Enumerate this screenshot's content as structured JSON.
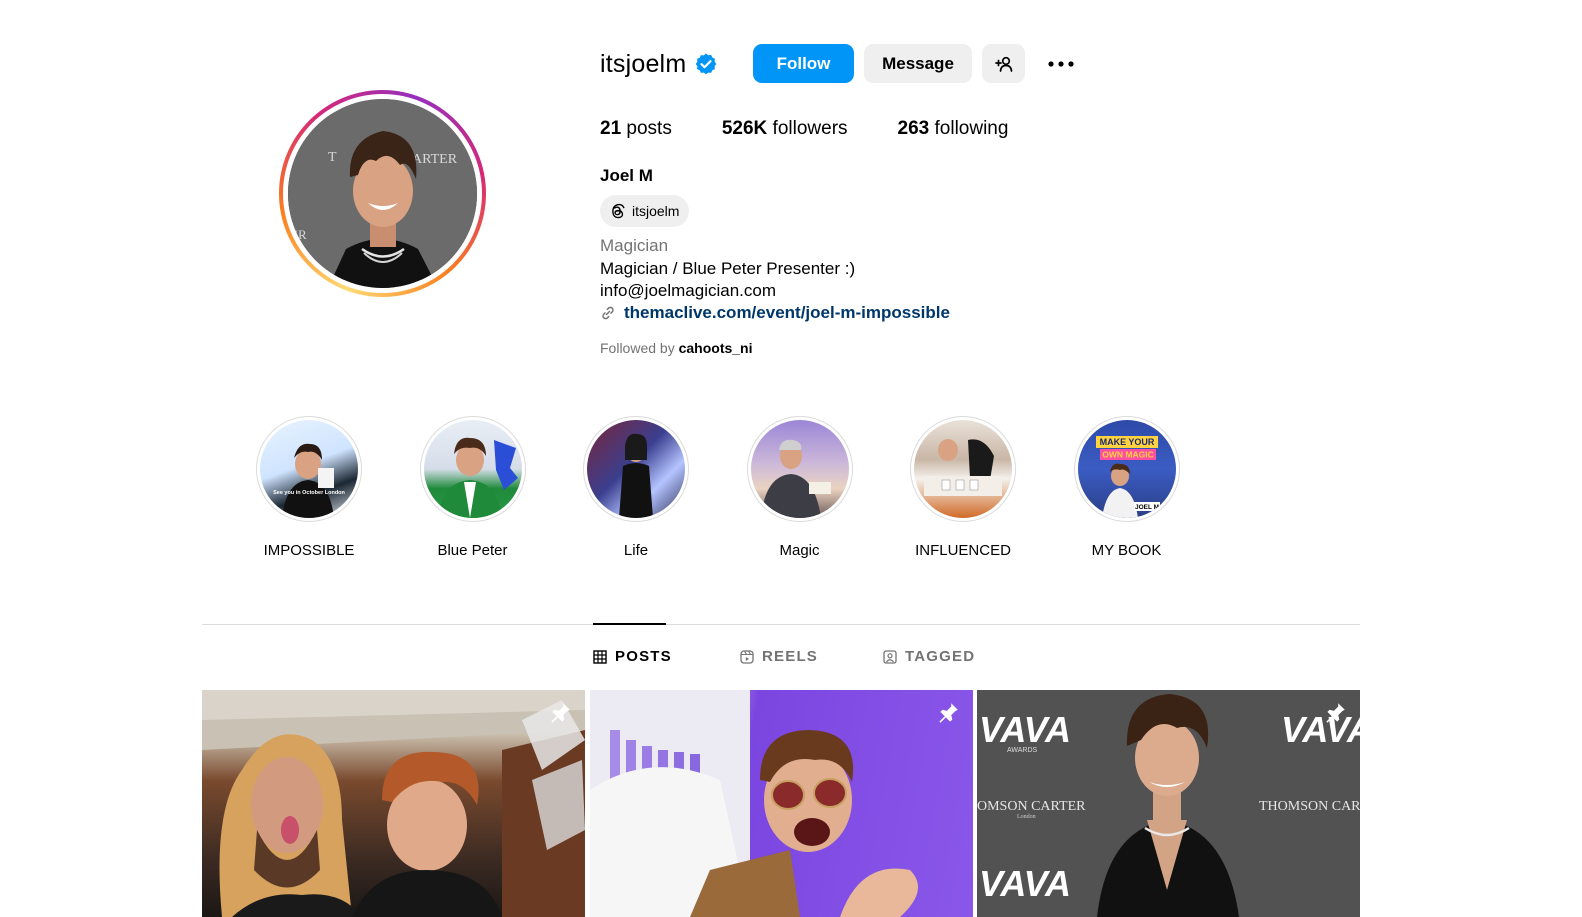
{
  "profile": {
    "username": "itsjoelm",
    "full_name": "Joel M",
    "threads_handle": "itsjoelm",
    "category": "Magician",
    "bio_line_1": "Magician / Blue Peter Presenter :)",
    "bio_line_2": "info@joelmagician.com",
    "link": "themaclive.com/event/joel-m-impossible",
    "followed_by_prefix": "Followed by ",
    "followed_by_user": "cahoots_ni",
    "avatar_sign_text_1": "T",
    "avatar_sign_text_2": "ARTER",
    "avatar_sign_text_3": "ER"
  },
  "actions": {
    "follow_label": "Follow",
    "message_label": "Message"
  },
  "stats": {
    "posts_count": "21",
    "posts_label": " posts",
    "followers_count": "526K",
    "followers_label": " followers",
    "following_count": "263",
    "following_label": " following"
  },
  "highlights": [
    {
      "label": "IMPOSSIBLE"
    },
    {
      "label": "Blue Peter"
    },
    {
      "label": "Life"
    },
    {
      "label": "Magic"
    },
    {
      "label": "INFLUENCED"
    },
    {
      "label": "MY BOOK"
    }
  ],
  "highlight_texts": {
    "impossible_banner": "See you in October London",
    "book_title_1": "MAKE YOUR",
    "book_title_2": "OWN MAGIC",
    "book_author": "JOEL M"
  },
  "tabs": {
    "posts": "POSTS",
    "reels": "REELS",
    "tagged": "TAGGED"
  },
  "post_texts": {
    "vava_1": "VAVA",
    "awards": "AWARDS",
    "thomson": "OMSON CARTER",
    "thomson_2": "THOMSON CAR",
    "london": "London",
    "vava_2": "VAVA"
  },
  "colors": {
    "accent": "#0095f6",
    "link": "#00376b",
    "secondary_text": "#737373",
    "button_bg": "#efefef"
  },
  "icons": {
    "verified": "verified-badge-icon",
    "add_user": "add-user-icon",
    "more": "more-options-icon",
    "threads": "threads-icon",
    "link": "link-icon",
    "grid": "grid-icon",
    "reels": "reels-icon",
    "tagged": "tagged-icon",
    "pin": "pin-icon"
  }
}
